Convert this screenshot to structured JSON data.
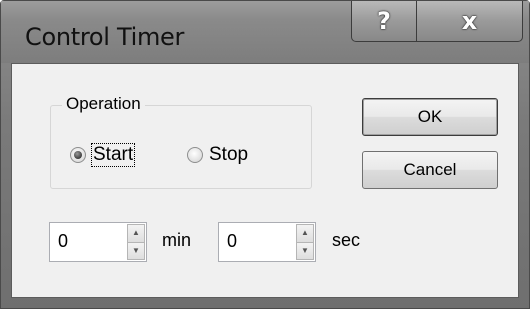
{
  "window": {
    "title": "Control Timer",
    "help_label": "?",
    "close_label": "x"
  },
  "operation": {
    "group_label": "Operation",
    "options": [
      {
        "label": "Start",
        "selected": true
      },
      {
        "label": "Stop",
        "selected": false
      }
    ]
  },
  "buttons": {
    "ok_label": "OK",
    "cancel_label": "Cancel"
  },
  "timer": {
    "minutes_value": "0",
    "minutes_unit": "min",
    "seconds_value": "0",
    "seconds_unit": "sec"
  },
  "icons": {
    "spin_up": "▲",
    "spin_down": "▼"
  }
}
